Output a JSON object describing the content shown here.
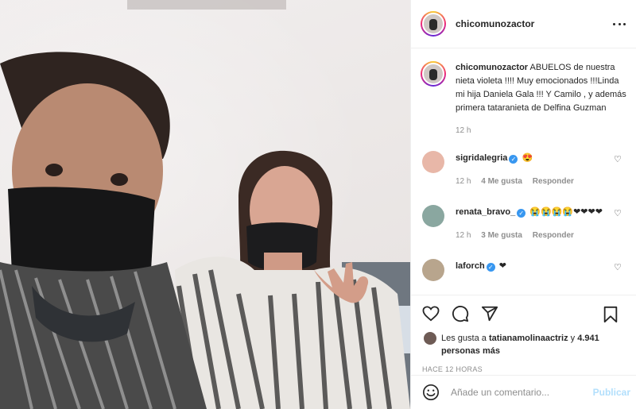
{
  "post": {
    "username": "chicomunozactor",
    "caption_text": "ABUELOS de nuestra nieta violeta !!!! Muy emocionados !!!Linda mi hija Daniela Gala !!! Y Camilo , y además primera tataranieta de Delfina Guzman",
    "caption_time": "12 h"
  },
  "comments": [
    {
      "username": "sigridalegria",
      "text": "😍",
      "time": "12 h",
      "likes": "4 Me gusta",
      "reply": "Responder",
      "avatar_color": "#e8b7a8"
    },
    {
      "username": "renata_bravo_",
      "text": "😭😭😭😭❤❤❤❤",
      "time": "12 h",
      "likes": "3 Me gusta",
      "reply": "Responder",
      "avatar_color": "#8aa7a0"
    },
    {
      "username": "laforch",
      "text": "❤",
      "time": "",
      "likes": "",
      "reply": "",
      "avatar_color": "#b8a58d"
    }
  ],
  "likes": {
    "prefix": "Les gusta a ",
    "user": "tatianamolinaactriz",
    "connector": " y",
    "count": "4.941 personas más"
  },
  "timestamp": "HACE 12 HORAS",
  "add_comment": {
    "placeholder": "Añade un comentario...",
    "post_label": "Publicar"
  },
  "icons": {
    "more": "more-horizontal-icon",
    "like": "heart-icon",
    "comment": "comment-icon",
    "share": "paper-plane-icon",
    "save": "bookmark-icon",
    "emoji": "smiley-icon"
  },
  "colors": {
    "verified": "#3897f0",
    "muted": "#8e8e8e",
    "publish": "#b2dffc"
  }
}
